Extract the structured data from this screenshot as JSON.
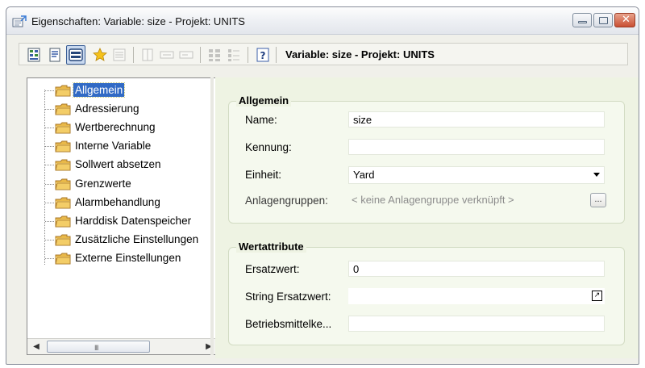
{
  "window": {
    "title": "Eigenschaften: Variable: size - Projekt: UNITS",
    "icon": "properties-document-icon",
    "minimize_icon": "minimize-icon",
    "maximize_icon": "maximize-icon",
    "close_icon": "close-icon",
    "close_glyph": "✕"
  },
  "toolbar": {
    "title": "Variable: size - Projekt: UNITS",
    "buttons": [
      {
        "icon": "grid-view-icon",
        "enabled": true
      },
      {
        "icon": "list-view-icon",
        "enabled": true
      },
      {
        "icon": "tab-view-icon",
        "enabled": true,
        "pressed": true
      },
      {
        "icon": "favorites-star-icon",
        "enabled": true
      },
      {
        "icon": "properties-icon",
        "enabled": false
      },
      {
        "icon": "layout-icon-1",
        "enabled": false
      },
      {
        "icon": "layout-icon-2",
        "enabled": false
      },
      {
        "icon": "layout-icon-3",
        "enabled": false
      },
      {
        "icon": "columns-icon",
        "enabled": false
      },
      {
        "icon": "tree-icon",
        "enabled": false
      },
      {
        "icon": "help-icon",
        "enabled": true
      }
    ]
  },
  "tree": {
    "items": [
      {
        "label": "Allgemein",
        "selected": true
      },
      {
        "label": "Adressierung"
      },
      {
        "label": "Wertberechnung"
      },
      {
        "label": "Interne Variable"
      },
      {
        "label": "Sollwert absetzen"
      },
      {
        "label": "Grenzwerte"
      },
      {
        "label": "Alarmbehandlung"
      },
      {
        "label": "Harddisk Datenspeicher"
      },
      {
        "label": "Zusätzliche Einstellungen"
      },
      {
        "label": "Externe Einstellungen"
      }
    ],
    "scroll_left": "◀",
    "scroll_right": "▶",
    "scroll_grip": "III"
  },
  "general": {
    "title": "Allgemein",
    "name_label": "Name:",
    "name_value": "size",
    "kennung_label": "Kennung:",
    "kennung_value": "",
    "einheit_label": "Einheit:",
    "einheit_value": "Yard",
    "anlagengruppen_label": "Anlagengruppen:",
    "anlagengruppen_value": "< keine Anlagengruppe verknüpft >",
    "browse_label": "..."
  },
  "value_attributes": {
    "title": "Wertattribute",
    "ersatzwert_label": "Ersatzwert:",
    "ersatzwert_value": "0",
    "string_ersatzwert_label": "String Ersatzwert:",
    "string_ersatzwert_value": "",
    "expand_glyph": "↗",
    "betriebsmittel_label": "Betriebsmittelke...",
    "betriebsmittel_value": ""
  },
  "colors": {
    "selection": "#316ac5",
    "panel_background": "#eef3e3"
  }
}
